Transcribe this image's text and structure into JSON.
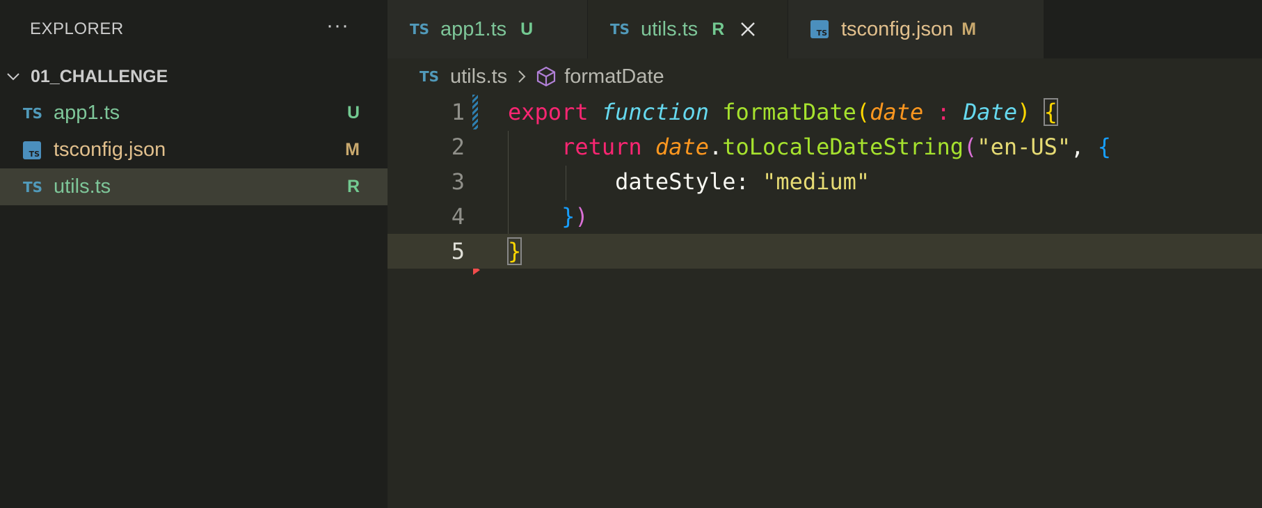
{
  "sidebar": {
    "title": "EXPLORER",
    "more_label": "···",
    "section": "01_CHALLENGE",
    "files": [
      {
        "icon": "TS",
        "name": "app1.ts",
        "status": "U"
      },
      {
        "icon": "TS",
        "name": "tsconfig.json",
        "status": "M"
      },
      {
        "icon": "TS",
        "name": "utils.ts",
        "status": "R"
      }
    ]
  },
  "tabs": [
    {
      "icon": "TS",
      "name": "app1.ts",
      "status": "U"
    },
    {
      "icon": "TS",
      "name": "utils.ts",
      "status": "R"
    },
    {
      "icon": "TS",
      "name": "tsconfig.json",
      "status": "M"
    }
  ],
  "breadcrumb": {
    "icon": "TS",
    "file": "utils.ts",
    "symbol": "formatDate"
  },
  "editor": {
    "line_numbers": [
      "1",
      "2",
      "3",
      "4",
      "5"
    ],
    "tokens": {
      "export": "export",
      "function": "function",
      "fn_name": "formatDate",
      "paren_open": "(",
      "param": "date",
      "colon": " : ",
      "type": "Date",
      "paren_close": ")",
      "brace_open": "{",
      "return": "return",
      "date_ref": "date",
      "dot": ".",
      "method": "toLocaleDateString",
      "call_open": "(",
      "locale": "\"en-US\"",
      "comma": ",",
      "obj_open": "{",
      "prop": "dateStyle:",
      "prop_value": "\"medium\"",
      "obj_close": "}",
      "call_close": ")",
      "brace_close": "}"
    }
  },
  "colors": {
    "sidebar_bg": "#1e1f1c",
    "editor_bg": "#272822",
    "selected_row": "#3e3f35",
    "untracked": "#73c991",
    "modified": "#c9a96e",
    "ts_icon": "#519aba"
  }
}
